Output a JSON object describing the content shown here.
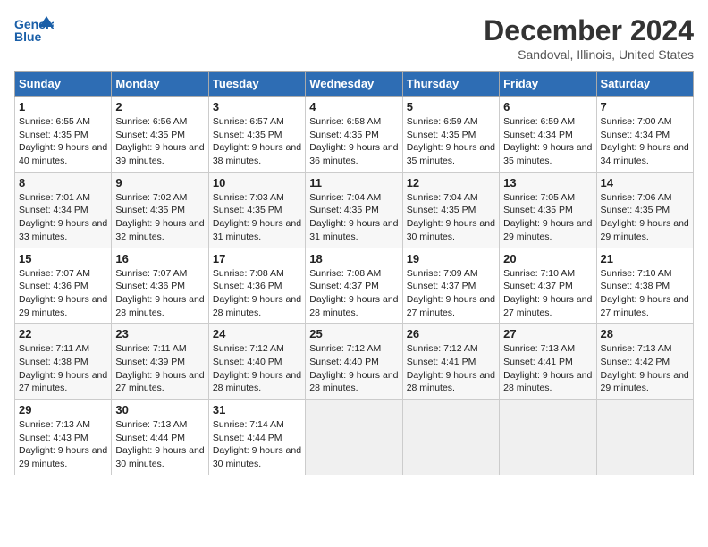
{
  "header": {
    "logo_text_line1": "General",
    "logo_text_line2": "Blue",
    "month_title": "December 2024",
    "location": "Sandoval, Illinois, United States"
  },
  "weekdays": [
    "Sunday",
    "Monday",
    "Tuesday",
    "Wednesday",
    "Thursday",
    "Friday",
    "Saturday"
  ],
  "weeks": [
    [
      {
        "day": "1",
        "sunrise": "6:55 AM",
        "sunset": "4:35 PM",
        "daylight": "9 hours and 40 minutes."
      },
      {
        "day": "2",
        "sunrise": "6:56 AM",
        "sunset": "4:35 PM",
        "daylight": "9 hours and 39 minutes."
      },
      {
        "day": "3",
        "sunrise": "6:57 AM",
        "sunset": "4:35 PM",
        "daylight": "9 hours and 38 minutes."
      },
      {
        "day": "4",
        "sunrise": "6:58 AM",
        "sunset": "4:35 PM",
        "daylight": "9 hours and 36 minutes."
      },
      {
        "day": "5",
        "sunrise": "6:59 AM",
        "sunset": "4:35 PM",
        "daylight": "9 hours and 35 minutes."
      },
      {
        "day": "6",
        "sunrise": "6:59 AM",
        "sunset": "4:34 PM",
        "daylight": "9 hours and 35 minutes."
      },
      {
        "day": "7",
        "sunrise": "7:00 AM",
        "sunset": "4:34 PM",
        "daylight": "9 hours and 34 minutes."
      }
    ],
    [
      {
        "day": "8",
        "sunrise": "7:01 AM",
        "sunset": "4:34 PM",
        "daylight": "9 hours and 33 minutes."
      },
      {
        "day": "9",
        "sunrise": "7:02 AM",
        "sunset": "4:35 PM",
        "daylight": "9 hours and 32 minutes."
      },
      {
        "day": "10",
        "sunrise": "7:03 AM",
        "sunset": "4:35 PM",
        "daylight": "9 hours and 31 minutes."
      },
      {
        "day": "11",
        "sunrise": "7:04 AM",
        "sunset": "4:35 PM",
        "daylight": "9 hours and 31 minutes."
      },
      {
        "day": "12",
        "sunrise": "7:04 AM",
        "sunset": "4:35 PM",
        "daylight": "9 hours and 30 minutes."
      },
      {
        "day": "13",
        "sunrise": "7:05 AM",
        "sunset": "4:35 PM",
        "daylight": "9 hours and 29 minutes."
      },
      {
        "day": "14",
        "sunrise": "7:06 AM",
        "sunset": "4:35 PM",
        "daylight": "9 hours and 29 minutes."
      }
    ],
    [
      {
        "day": "15",
        "sunrise": "7:07 AM",
        "sunset": "4:36 PM",
        "daylight": "9 hours and 29 minutes."
      },
      {
        "day": "16",
        "sunrise": "7:07 AM",
        "sunset": "4:36 PM",
        "daylight": "9 hours and 28 minutes."
      },
      {
        "day": "17",
        "sunrise": "7:08 AM",
        "sunset": "4:36 PM",
        "daylight": "9 hours and 28 minutes."
      },
      {
        "day": "18",
        "sunrise": "7:08 AM",
        "sunset": "4:37 PM",
        "daylight": "9 hours and 28 minutes."
      },
      {
        "day": "19",
        "sunrise": "7:09 AM",
        "sunset": "4:37 PM",
        "daylight": "9 hours and 27 minutes."
      },
      {
        "day": "20",
        "sunrise": "7:10 AM",
        "sunset": "4:37 PM",
        "daylight": "9 hours and 27 minutes."
      },
      {
        "day": "21",
        "sunrise": "7:10 AM",
        "sunset": "4:38 PM",
        "daylight": "9 hours and 27 minutes."
      }
    ],
    [
      {
        "day": "22",
        "sunrise": "7:11 AM",
        "sunset": "4:38 PM",
        "daylight": "9 hours and 27 minutes."
      },
      {
        "day": "23",
        "sunrise": "7:11 AM",
        "sunset": "4:39 PM",
        "daylight": "9 hours and 27 minutes."
      },
      {
        "day": "24",
        "sunrise": "7:12 AM",
        "sunset": "4:40 PM",
        "daylight": "9 hours and 28 minutes."
      },
      {
        "day": "25",
        "sunrise": "7:12 AM",
        "sunset": "4:40 PM",
        "daylight": "9 hours and 28 minutes."
      },
      {
        "day": "26",
        "sunrise": "7:12 AM",
        "sunset": "4:41 PM",
        "daylight": "9 hours and 28 minutes."
      },
      {
        "day": "27",
        "sunrise": "7:13 AM",
        "sunset": "4:41 PM",
        "daylight": "9 hours and 28 minutes."
      },
      {
        "day": "28",
        "sunrise": "7:13 AM",
        "sunset": "4:42 PM",
        "daylight": "9 hours and 29 minutes."
      }
    ],
    [
      {
        "day": "29",
        "sunrise": "7:13 AM",
        "sunset": "4:43 PM",
        "daylight": "9 hours and 29 minutes."
      },
      {
        "day": "30",
        "sunrise": "7:13 AM",
        "sunset": "4:44 PM",
        "daylight": "9 hours and 30 minutes."
      },
      {
        "day": "31",
        "sunrise": "7:14 AM",
        "sunset": "4:44 PM",
        "daylight": "9 hours and 30 minutes."
      },
      null,
      null,
      null,
      null
    ]
  ]
}
